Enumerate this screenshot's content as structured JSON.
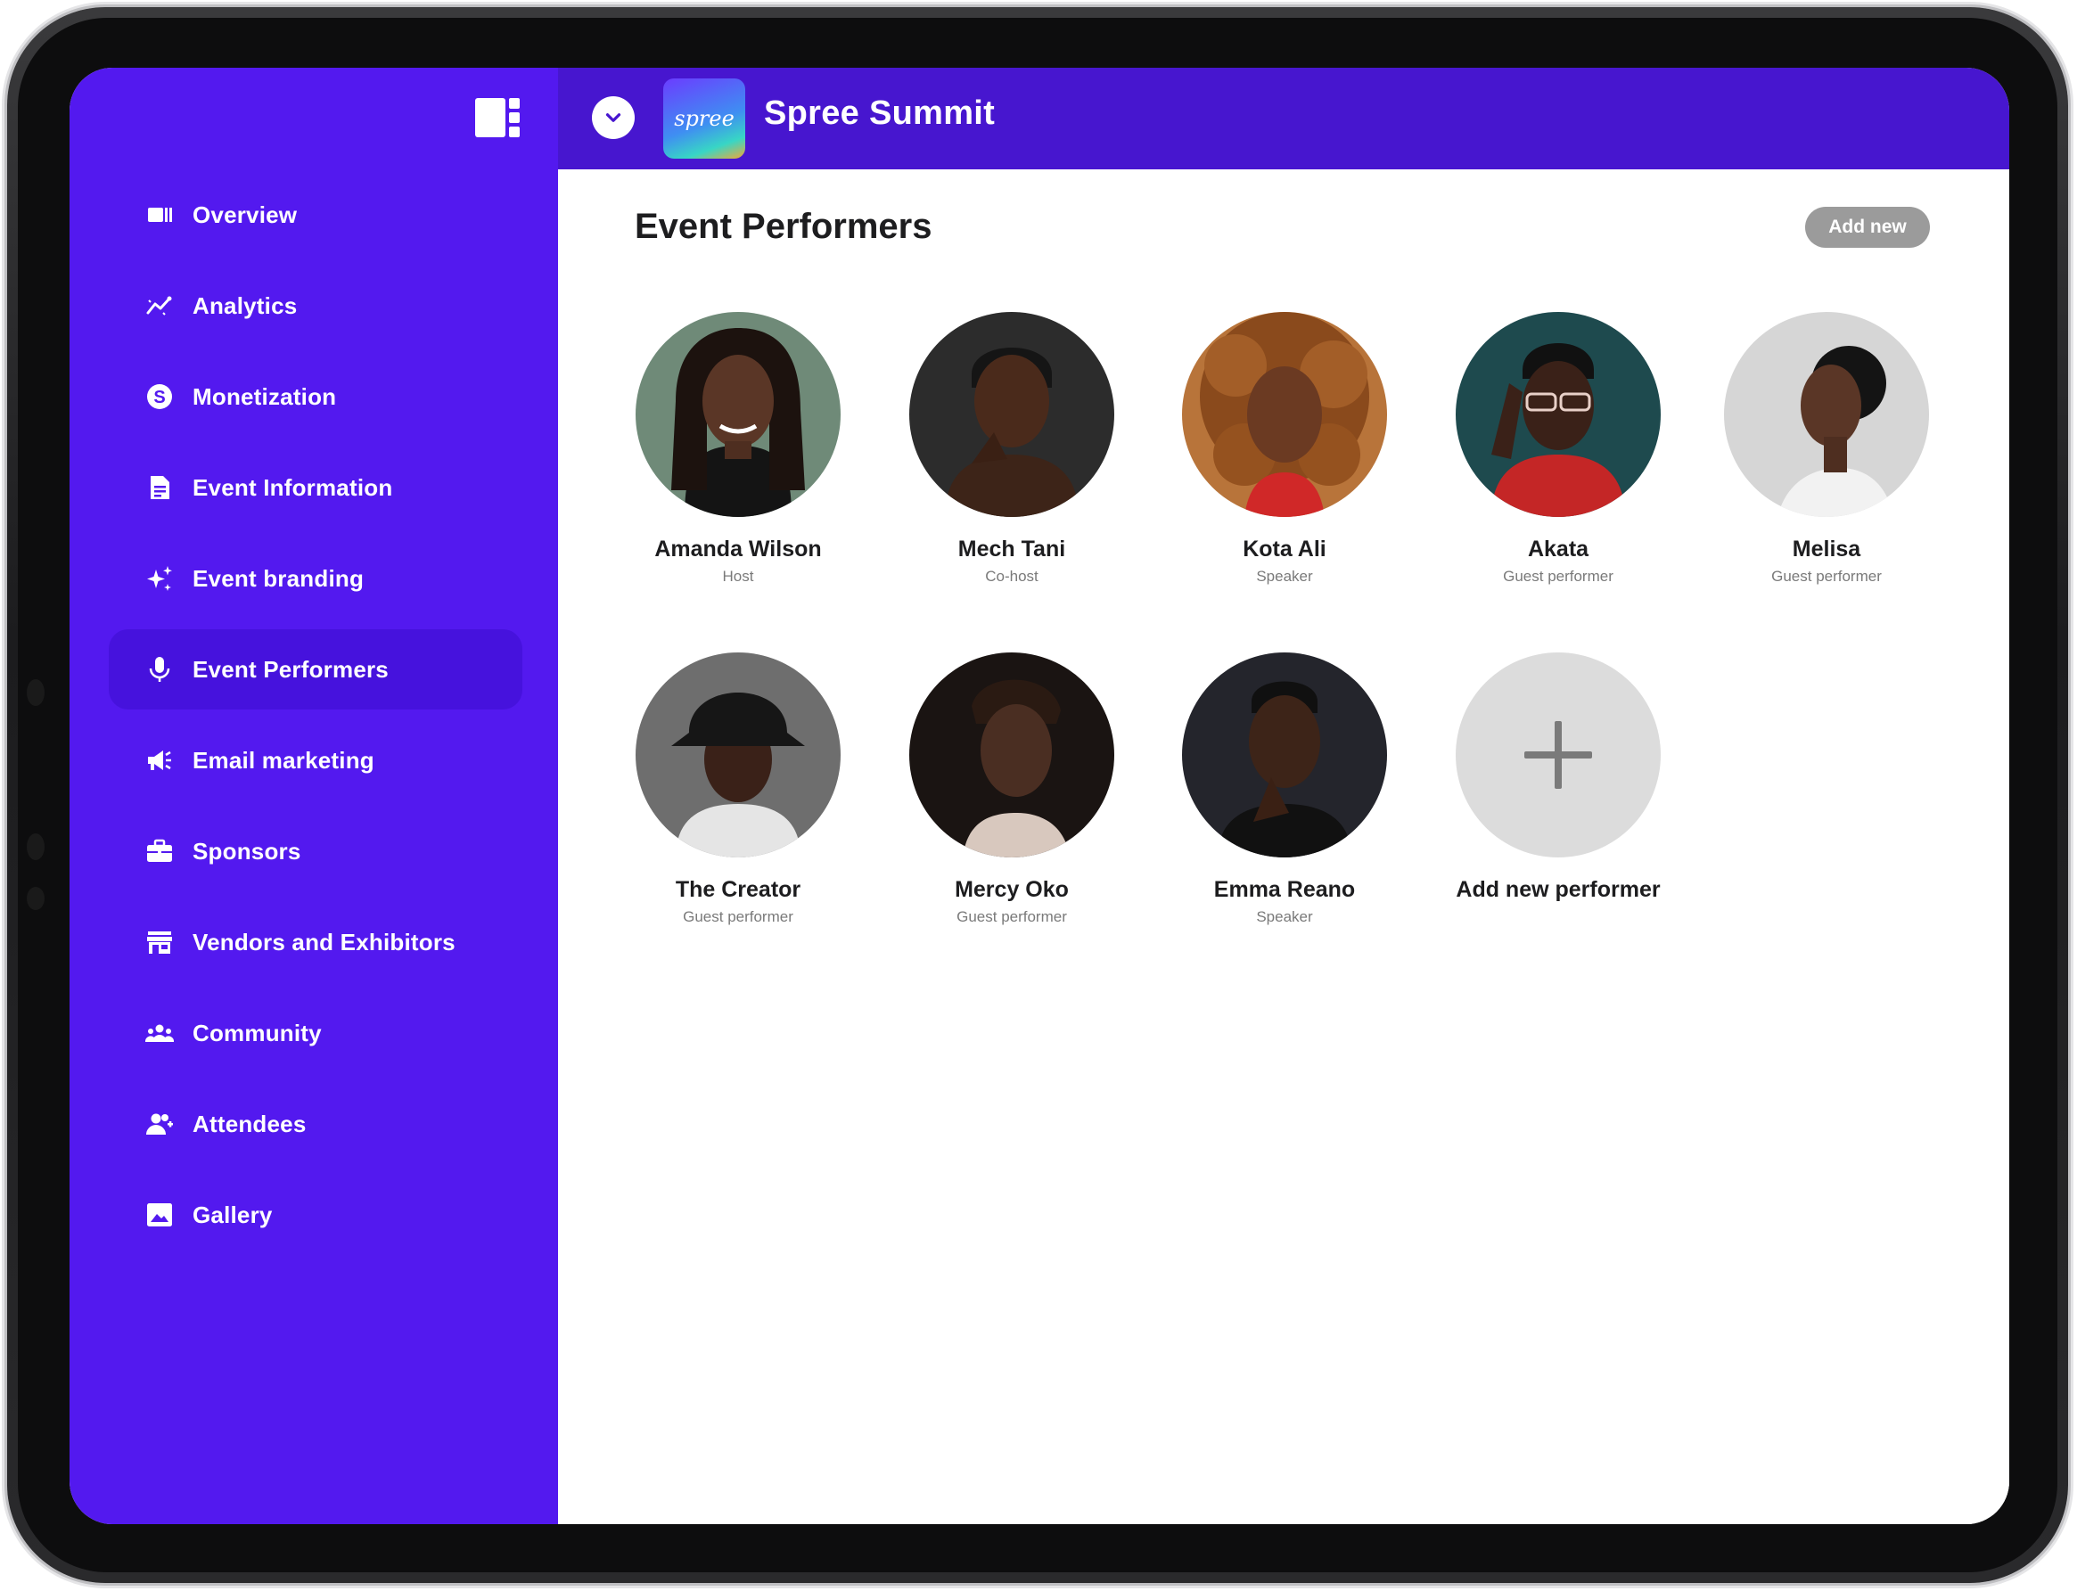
{
  "app": {
    "title": "Spree Summit",
    "logo_text": "spree"
  },
  "sidebar": {
    "items": [
      {
        "label": "Overview",
        "icon": "overview-icon",
        "active": false
      },
      {
        "label": "Analytics",
        "icon": "analytics-icon",
        "active": false
      },
      {
        "label": "Monetization",
        "icon": "dollar-icon",
        "active": false
      },
      {
        "label": "Event Information",
        "icon": "document-icon",
        "active": false
      },
      {
        "label": "Event branding",
        "icon": "sparkle-icon",
        "active": false
      },
      {
        "label": "Event Performers",
        "icon": "microphone-icon",
        "active": true
      },
      {
        "label": "Email marketing",
        "icon": "megaphone-icon",
        "active": false
      },
      {
        "label": "Sponsors",
        "icon": "briefcase-icon",
        "active": false
      },
      {
        "label": "Vendors and Exhibitors",
        "icon": "store-icon",
        "active": false
      },
      {
        "label": "Community",
        "icon": "community-icon",
        "active": false
      },
      {
        "label": "Attendees",
        "icon": "attendees-icon",
        "active": false
      },
      {
        "label": "Gallery",
        "icon": "image-icon",
        "active": false
      }
    ]
  },
  "main": {
    "title": "Event Performers",
    "add_button": "Add new",
    "performers": [
      {
        "name": "Amanda Wilson",
        "role": "Host"
      },
      {
        "name": "Mech Tani",
        "role": "Co-host"
      },
      {
        "name": "Kota Ali",
        "role": "Speaker"
      },
      {
        "name": "Akata",
        "role": "Guest performer"
      },
      {
        "name": "Melisa",
        "role": "Guest performer"
      },
      {
        "name": "The Creator",
        "role": "Guest performer"
      },
      {
        "name": "Mercy Oko",
        "role": "Guest performer"
      },
      {
        "name": "Emma Reano",
        "role": "Speaker"
      }
    ],
    "add_performer_label": "Add new performer"
  },
  "colors": {
    "sidebar": "#5319ef",
    "sidebar_active": "#4612dd",
    "topbar": "#4716cf",
    "add_button": "#9b9b9b"
  }
}
